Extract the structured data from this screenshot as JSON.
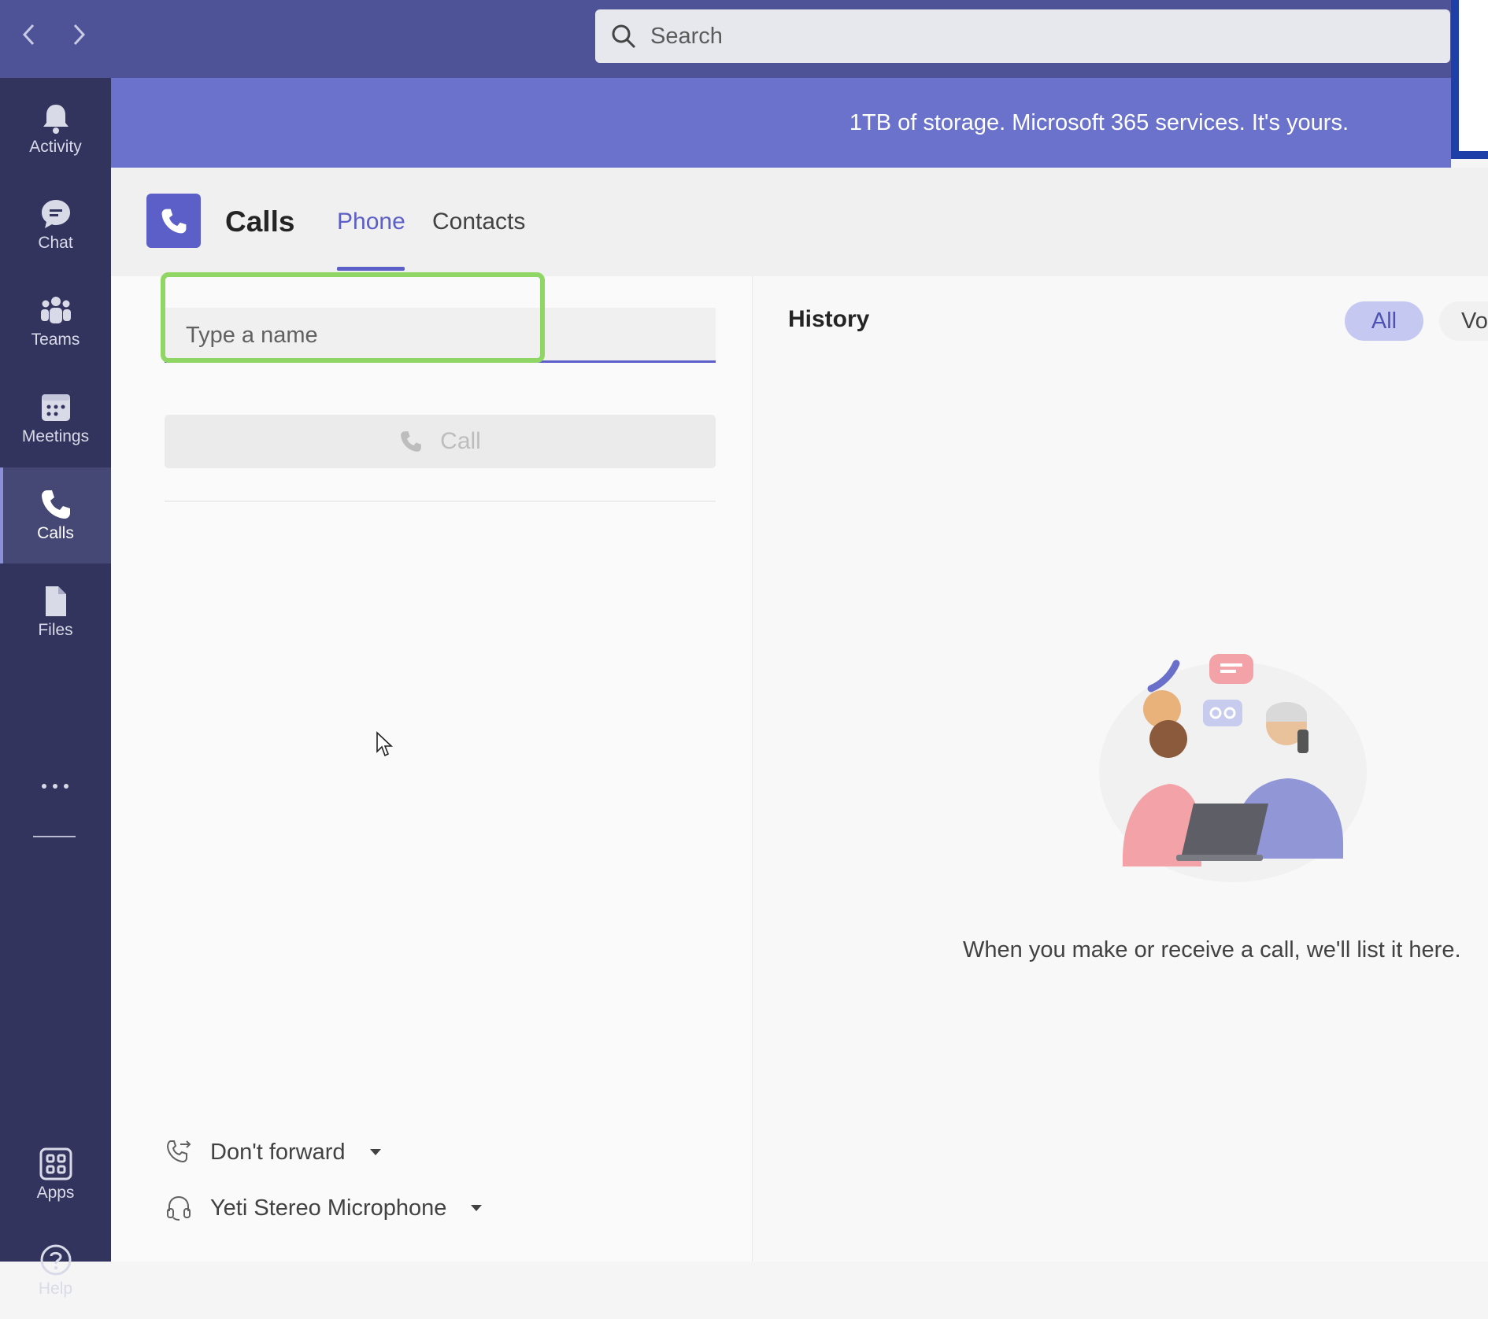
{
  "search": {
    "placeholder": "Search"
  },
  "banner": {
    "text": "1TB of storage. Microsoft 365 services. It's yours."
  },
  "rail": {
    "items": [
      {
        "label": "Activity",
        "icon": "bell-icon"
      },
      {
        "label": "Chat",
        "icon": "chat-icon"
      },
      {
        "label": "Teams",
        "icon": "teams-icon"
      },
      {
        "label": "Meetings",
        "icon": "calendar-icon"
      },
      {
        "label": "Calls",
        "icon": "phone-icon",
        "active": true
      },
      {
        "label": "Files",
        "icon": "file-icon"
      }
    ],
    "apps_label": "Apps",
    "help_label": "Help"
  },
  "header": {
    "title": "Calls",
    "tabs": [
      {
        "label": "Phone",
        "active": true
      },
      {
        "label": "Contacts"
      }
    ]
  },
  "dialer": {
    "name_placeholder": "Type a name",
    "call_label": "Call",
    "forward_label": "Don't forward",
    "device_label": "Yeti Stereo Microphone"
  },
  "history": {
    "title": "History",
    "filters": [
      "All",
      "Vo"
    ],
    "empty_message": "When you make or receive a call, we'll list it here."
  },
  "colors": {
    "titlebar": "#4d5396",
    "rail": "#33345e",
    "banner": "#6a72cb",
    "accent": "#5b5fc7",
    "highlight": "#8fd665"
  }
}
